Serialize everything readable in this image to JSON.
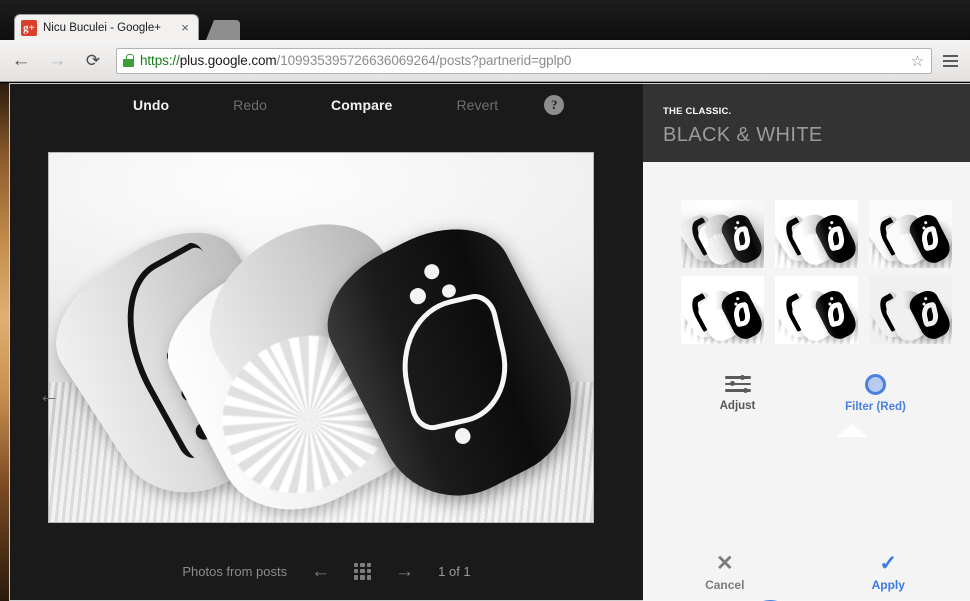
{
  "browser": {
    "tab": {
      "title": "Nicu Buculei - Google+",
      "favicon_label": "g+",
      "favicon_name": "google-plus-favicon",
      "close_glyph": "×"
    },
    "newtab_name": "new-tab-button",
    "nav": {
      "back_glyph": "←",
      "forward_glyph": "→",
      "reload_glyph": "⟳"
    },
    "url": {
      "scheme": "https://",
      "host": "plus.google.com",
      "path": "/109935395726636069264/posts?partnerid=gplp0",
      "full": "https://plus.google.com/109935395726636069264/posts?partnerid=gplp0"
    },
    "star_glyph": "☆",
    "menu_name": "chrome-menu-button"
  },
  "editor": {
    "toolbar": {
      "undo": "Undo",
      "redo": "Redo",
      "compare": "Compare",
      "revert": "Revert",
      "help_glyph": "?"
    },
    "photo": {
      "alt": "black and white photo of three eclairs on a doily",
      "prev_glyph": "←"
    },
    "bottombar": {
      "source_label": "Photos from posts",
      "prev_glyph": "←",
      "grid_glyph": "grid-icon",
      "next_glyph": "→",
      "counter": "1 of 1"
    }
  },
  "panel": {
    "kicker": "THE CLASSIC.",
    "title": "BLACK & WHITE",
    "presets": [
      {
        "name": "preset-1",
        "label": "Black & White preset 1"
      },
      {
        "name": "preset-2",
        "label": "Black & White preset 2"
      },
      {
        "name": "preset-3",
        "label": "Black & White preset 3"
      },
      {
        "name": "preset-4",
        "label": "Black & White preset 4"
      },
      {
        "name": "preset-5",
        "label": "Black & White preset 5"
      },
      {
        "name": "preset-6",
        "label": "Black & White preset 6"
      }
    ],
    "modes": {
      "adjust": {
        "label": "Adjust",
        "selected": false
      },
      "filter": {
        "label": "Filter (Red)",
        "selected": true
      }
    },
    "swatches": [
      {
        "name": "swatch-neutral",
        "color": "#7e7e7e",
        "selected": false
      },
      {
        "name": "swatch-red",
        "color": "#b95b5d",
        "selected": true
      },
      {
        "name": "swatch-orange",
        "color": "#d0883d",
        "selected": false
      }
    ],
    "accent_color": "#4a7fe0",
    "actions": {
      "cancel": {
        "label": "Cancel",
        "glyph": "✕"
      },
      "apply": {
        "label": "Apply",
        "glyph": "✓"
      }
    }
  }
}
